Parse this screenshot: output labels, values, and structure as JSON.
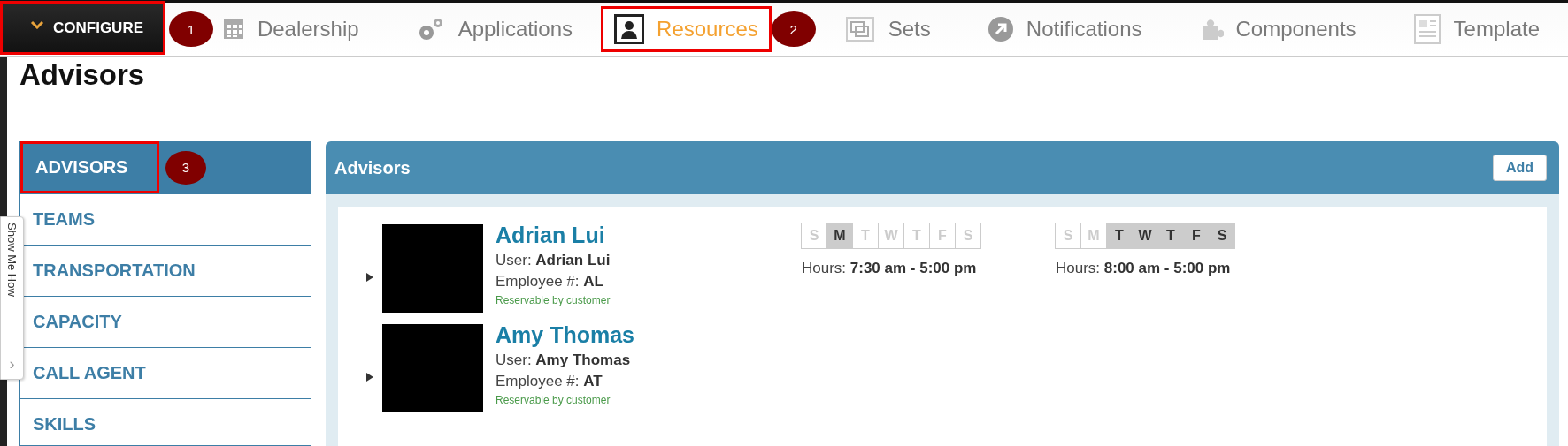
{
  "configure_button": {
    "label": "CONFIGURE",
    "highlighted": true,
    "callout": "1"
  },
  "nav_tabs": [
    {
      "label": "Dealership",
      "selected": false,
      "highlighted": false
    },
    {
      "label": "Applications",
      "selected": false,
      "highlighted": false
    },
    {
      "label": "Resources",
      "selected": true,
      "highlighted": true,
      "callout": "2"
    },
    {
      "label": "Sets",
      "selected": false,
      "highlighted": false
    },
    {
      "label": "Notifications",
      "selected": false,
      "highlighted": false
    },
    {
      "label": "Components",
      "selected": false,
      "highlighted": false
    },
    {
      "label": "Template",
      "selected": false,
      "highlighted": false
    }
  ],
  "page_title": "Advisors",
  "show_me_how": {
    "label": "Show Me How",
    "arrow": "›"
  },
  "sidebar": {
    "items": [
      {
        "label": "ADVISORS",
        "selected": true,
        "highlighted": true,
        "callout": "3"
      },
      {
        "label": "TEAMS",
        "selected": false,
        "highlighted": false
      },
      {
        "label": "TRANSPORTATION",
        "selected": false,
        "highlighted": false
      },
      {
        "label": "CAPACITY",
        "selected": false,
        "highlighted": false
      },
      {
        "label": "CALL AGENT",
        "selected": false,
        "highlighted": false
      },
      {
        "label": "SKILLS",
        "selected": false,
        "highlighted": false
      }
    ]
  },
  "panel": {
    "title": "Advisors",
    "add_button": "Add",
    "advisors": [
      {
        "name": "Adrian Lui",
        "user_label": "User:",
        "user": "Adrian Lui",
        "employee_label": "Employee #:",
        "employee": "AL",
        "reservable": "Reservable by customer",
        "schedules": [
          {
            "days": [
              {
                "label": "S",
                "on": false
              },
              {
                "label": "M",
                "on": true
              },
              {
                "label": "T",
                "on": false
              },
              {
                "label": "W",
                "on": false
              },
              {
                "label": "T",
                "on": false
              },
              {
                "label": "F",
                "on": false
              },
              {
                "label": "S",
                "on": false
              }
            ],
            "hours_label": "Hours:",
            "hours": "7:30 am - 5:00 pm"
          },
          {
            "days": [
              {
                "label": "S",
                "on": false
              },
              {
                "label": "M",
                "on": false
              },
              {
                "label": "T",
                "on": true
              },
              {
                "label": "W",
                "on": true
              },
              {
                "label": "T",
                "on": true
              },
              {
                "label": "F",
                "on": true
              },
              {
                "label": "S",
                "on": true
              }
            ],
            "hours_label": "Hours:",
            "hours": "8:00 am - 5:00 pm"
          }
        ]
      },
      {
        "name": "Amy Thomas",
        "user_label": "User:",
        "user": "Amy Thomas",
        "employee_label": "Employee #:",
        "employee": "AT",
        "reservable": "Reservable by customer"
      }
    ]
  }
}
